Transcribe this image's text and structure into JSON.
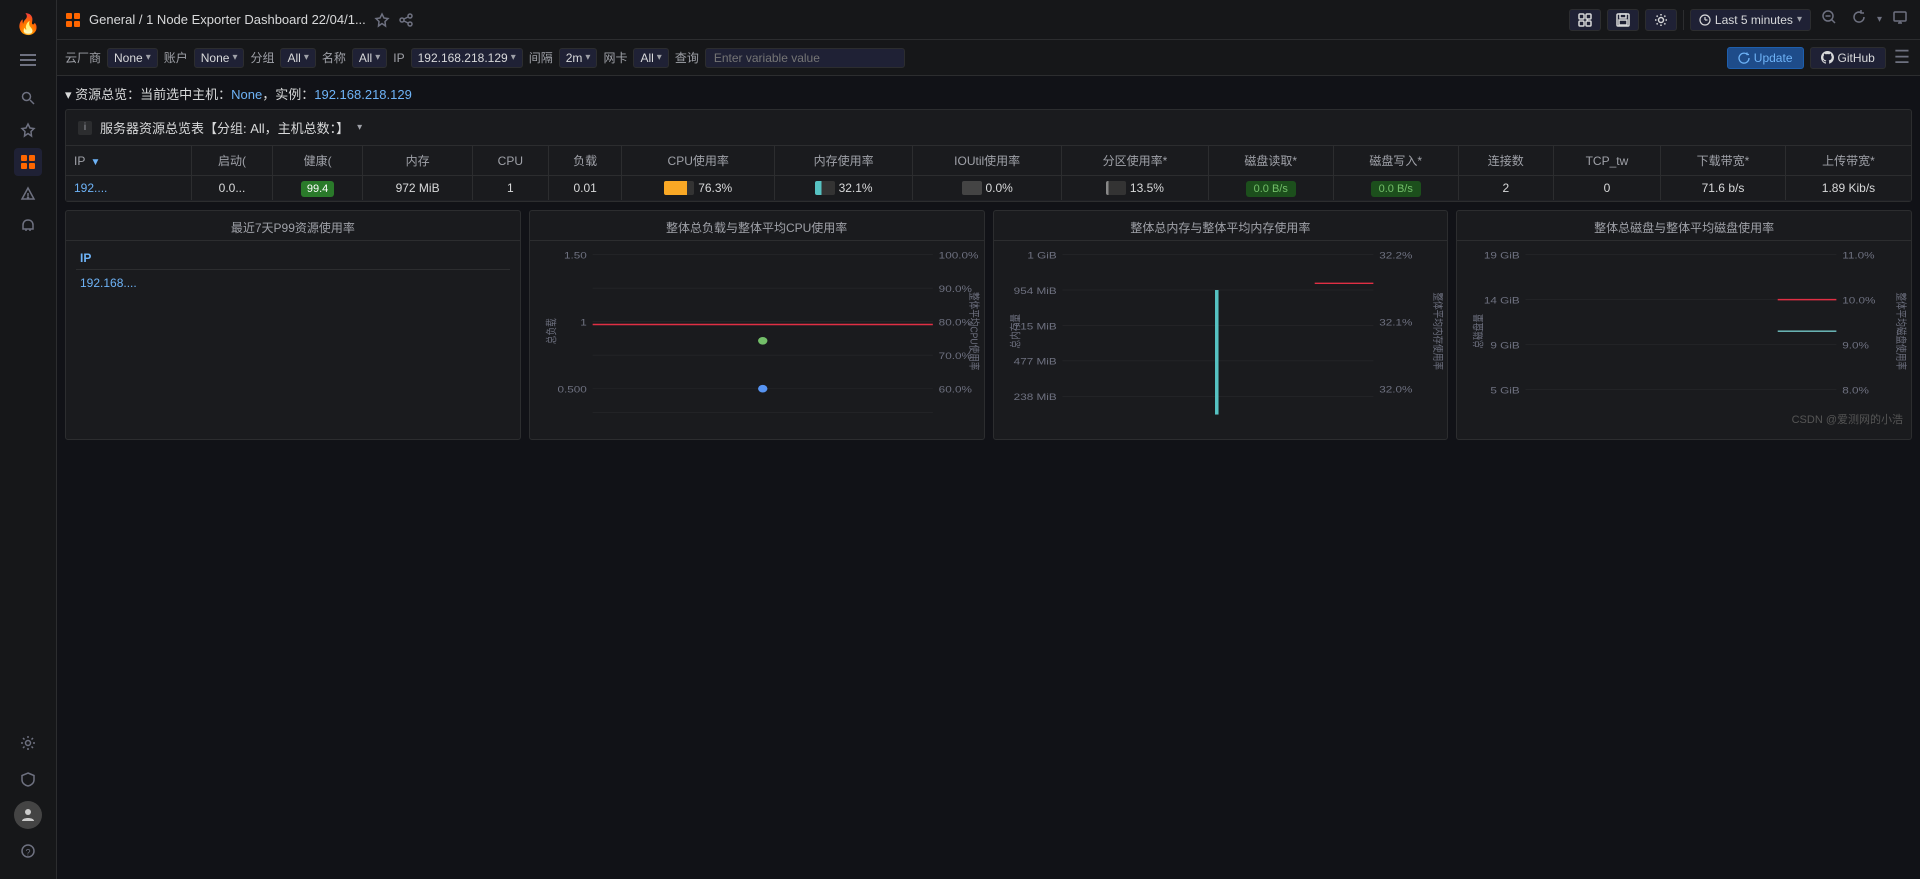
{
  "sidebar": {
    "logo_char": "🔥",
    "items": [
      {
        "id": "menu",
        "icon": "☰",
        "active": false
      },
      {
        "id": "search",
        "icon": "🔍",
        "active": false
      },
      {
        "id": "star",
        "icon": "☆",
        "active": false
      },
      {
        "id": "grid",
        "icon": "⊞",
        "active": true
      },
      {
        "id": "alert",
        "icon": "⚡",
        "active": false
      },
      {
        "id": "bell",
        "icon": "🔔",
        "active": false
      }
    ],
    "bottom": [
      {
        "id": "settings",
        "icon": "⚙"
      },
      {
        "id": "shield",
        "icon": "🛡"
      },
      {
        "id": "user",
        "icon": "👤"
      },
      {
        "id": "help",
        "icon": "?"
      }
    ]
  },
  "topnav": {
    "breadcrumb": "General  /  1 Node Exporter Dashboard 22/04/1...",
    "time_range": "Last 5 minutes",
    "icons": [
      "📊",
      "📋",
      "⚙"
    ]
  },
  "varbar": {
    "cloud_label": "云厂商",
    "cloud_value": "None",
    "account_label": "账户",
    "account_value": "None",
    "group_label": "分组",
    "group_value": "All",
    "name_label": "名称",
    "name_value": "All",
    "ip_label": "IP",
    "ip_value": "192.168.218.129",
    "interval_label": "间隔",
    "interval_value": "2m",
    "nic_label": "网卡",
    "nic_value": "All",
    "query_label": "查询",
    "query_placeholder": "Enter variable value",
    "update_label": "Update",
    "github_label": "GitHub"
  },
  "overview": {
    "title": "▾ 资源总览：当前选中主机：None，实例：192.168.218.129",
    "panel_title": "服务器资源总览表【分组: All，主机总数：】",
    "info_icon": "i",
    "columns": [
      "IP",
      "启动(",
      "健康(",
      "内存",
      "CPU",
      "负载",
      "CPU使用率",
      "内存使用率",
      "IOUtil使用率",
      "分区使用率*",
      "磁盘读取*",
      "磁盘写入*",
      "连接数",
      "TCP_tw",
      "下载带宽*",
      "上传带宽*"
    ],
    "row": {
      "ip": "192....",
      "uptime": "0.0...",
      "health": "99.4",
      "memory": "972 MiB",
      "cpu": "1",
      "load": "0.01",
      "cpu_pct": "76.3%",
      "mem_pct": "32.1%",
      "io_pct": "0.0%",
      "part_pct": "13.5%",
      "disk_read": "0.0 B/s",
      "disk_write": "0.0 B/s",
      "connections": "2",
      "tcp_tw": "0",
      "download": "71.6 b/s",
      "upload": "1.89 Kib/s"
    }
  },
  "bottom_panels": {
    "p99": {
      "title": "最近7天P99资源使用率",
      "col_ip": "IP",
      "row_ip": "192.168...."
    },
    "cpu_load": {
      "title": "整体总负载与整体平均CPU使用率",
      "y_labels": [
        "1.50",
        "1",
        "0.500"
      ],
      "y2_labels": [
        "100.0%",
        "90.0%",
        "80.0%",
        "70.0%",
        "60.0%"
      ],
      "y_axis": "总负载",
      "y2_axis": "整体平均CPU使用率",
      "dot_value": "1",
      "dot2_value": "0.500"
    },
    "memory": {
      "title": "整体总内存与整体平均内存使用率",
      "y_labels": [
        "1 GiB",
        "954 MiB",
        "715 MiB",
        "477 MiB",
        "238 MiB"
      ],
      "y2_labels": [
        "32.2%",
        "32.1%",
        "32.0%"
      ],
      "y_axis": "总内存量",
      "y2_axis": "整体平均内存使用率"
    },
    "disk": {
      "title": "整体总磁盘与整体平均磁盘使用率",
      "y_labels": [
        "19 GiB",
        "14 GiB",
        "9 GiB",
        "5 GiB"
      ],
      "y2_labels": [
        "11.0%",
        "10.0%",
        "9.0%",
        "8.0%"
      ],
      "y_axis": "总磁盘量",
      "y2_axis": "整体平均磁盘使用率"
    }
  },
  "watermark": "CSDN @爱测网的小浩"
}
